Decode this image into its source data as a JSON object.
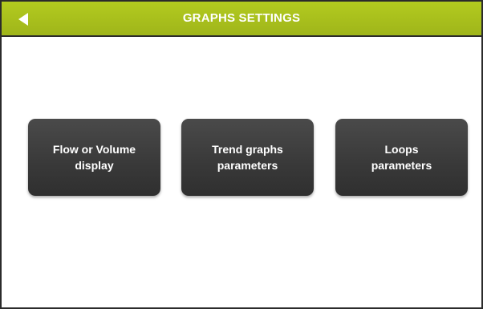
{
  "header": {
    "title": "GRAPHS SETTINGS",
    "back_icon": "back-arrow-icon",
    "bar_color": "#a9c11c"
  },
  "tiles": [
    {
      "label": "Flow or Volume\ndisplay"
    },
    {
      "label": "Trend graphs\nparameters"
    },
    {
      "label": "Loops\nparameters"
    }
  ],
  "colors": {
    "tile_bg": "#3c3c3c",
    "text": "#ffffff"
  }
}
